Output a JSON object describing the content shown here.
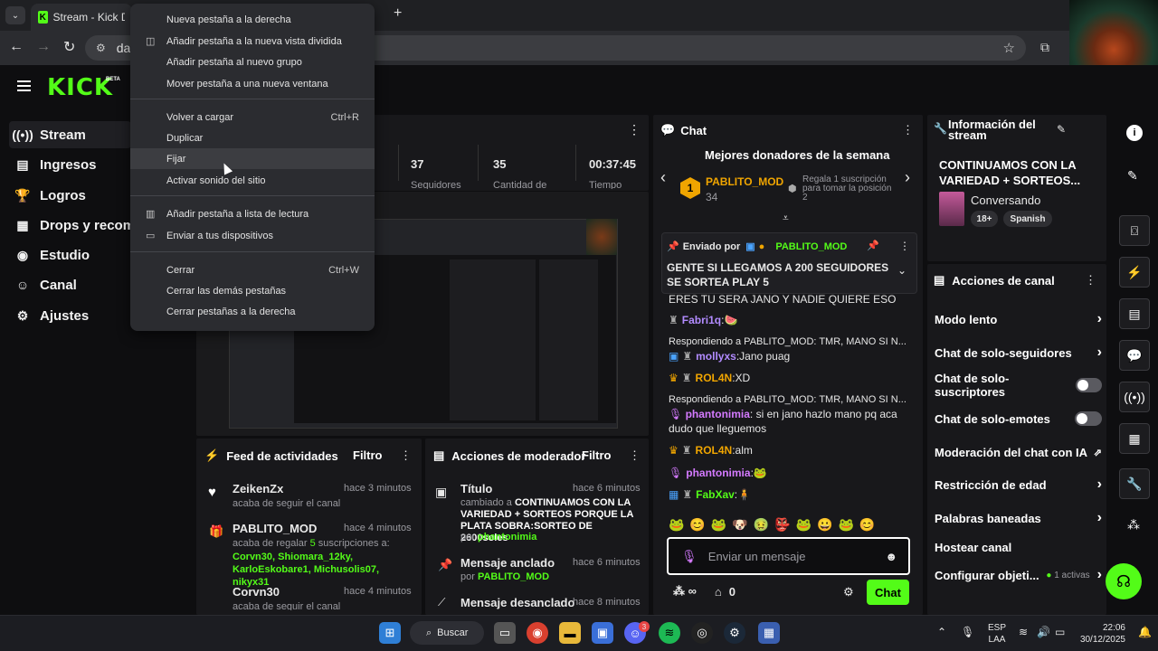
{
  "browser": {
    "tab_title": "Stream - Kick Dashl",
    "url": "da",
    "new_tab": "+"
  },
  "menu": {
    "items": [
      {
        "label": "Nueva pestaña a la derecha",
        "shortcut": ""
      },
      {
        "label": "Añadir pestaña a la nueva vista dividida",
        "shortcut": "",
        "icon": "split-view-icon"
      },
      {
        "label": "Añadir pestaña al nuevo grupo",
        "shortcut": ""
      },
      {
        "label": "Mover pestaña a una nueva ventana",
        "shortcut": ""
      },
      {
        "label": "Volver a cargar",
        "shortcut": "Ctrl+R"
      },
      {
        "label": "Duplicar",
        "shortcut": ""
      },
      {
        "label": "Fijar",
        "shortcut": ""
      },
      {
        "label": "Activar sonido del sitio",
        "shortcut": ""
      },
      {
        "label": "Añadir pestaña a lista de lectura",
        "shortcut": "",
        "icon": "reading-list-icon"
      },
      {
        "label": "Enviar a tus dispositivos",
        "shortcut": "",
        "icon": "devices-icon"
      },
      {
        "label": "Cerrar",
        "shortcut": "Ctrl+W"
      },
      {
        "label": "Cerrar las demás pestañas",
        "shortcut": ""
      },
      {
        "label": "Cerrar pestañas a la derecha",
        "shortcut": ""
      }
    ]
  },
  "kick": {
    "logo": "KICK",
    "beta": "BETA",
    "sidebar": [
      {
        "label": "Stream",
        "icon": "stream-icon"
      },
      {
        "label": "Ingresos",
        "icon": "chart-icon"
      },
      {
        "label": "Logros",
        "icon": "trophy-icon"
      },
      {
        "label": "Drops y recomp",
        "icon": "drops-icon"
      },
      {
        "label": "Estudio",
        "icon": "studio-icon"
      },
      {
        "label": "Canal",
        "icon": "channel-icon"
      },
      {
        "label": "Ajustes",
        "icon": "gear-icon"
      }
    ],
    "stats": [
      {
        "value": "37",
        "label": "Seguidores"
      },
      {
        "value": "35",
        "label": "Cantidad de"
      },
      {
        "value": "00:37:45",
        "label": "Tiempo"
      }
    ],
    "feed": {
      "title": "Feed de actividades",
      "filter": "Filtro",
      "items": [
        {
          "name": "ZeikenZx",
          "time": "hace 3 minutos",
          "text": "acaba de seguir el canal"
        },
        {
          "name": "PABLITO_MOD",
          "time": "hace 4 minutos",
          "text_pre": "acaba de regalar ",
          "count": "5",
          "text_post": " suscripciones a:",
          "recipients": "Corvn30, Shiomara_12ky, KarloEskobare1, Michusolis07, nikyx31"
        },
        {
          "name": "Corvn30",
          "time": "hace 4 minutos",
          "text": "acaba de seguir el canal"
        }
      ]
    },
    "mod": {
      "title": "Acciones de moderador",
      "filter": "Filtro",
      "items": [
        {
          "title": "Título",
          "time": "hace 6 minutos",
          "pre": "cambiado a ",
          "detail": "CONTINUAMOS CON LA VARIEDAD + SORTEOS PORQUE LA PLATA SOBRA:SORTEO DE 2600soles",
          "by_pre": "por ",
          "by": "phantonimia"
        },
        {
          "title": "Mensaje anclado",
          "time": "hace 6 minutos",
          "by_pre": "por ",
          "by": "PABLITO_MOD"
        },
        {
          "title": "Mensaje desanclado",
          "time": "hace 8 minutos"
        }
      ]
    },
    "chat": {
      "title": "Chat",
      "donors_title": "Mejores donadores de la semana",
      "donor": {
        "rank": "1",
        "name": "PABLITO_MOD",
        "amount": "34"
      },
      "gift_text": "Regala 1 suscripción para tomar la posición 2",
      "pinned_by_label": "Enviado por",
      "pinned_by": "PABLITO_MOD",
      "pinned_text": "GENTE SI LLEGAMOS A 200 SEGUIDORES SE SORTEA PLAY 5",
      "partial": "ERES TU SERA JANO Y NADIE QUIERE ESO",
      "messages": [
        {
          "user": "Fabri1q",
          "text": "",
          "color": "#b28bff"
        },
        {
          "reply": "Respondiendo a PABLITO_MOD: TMR, MANO SI N...",
          "user": "mollyxs",
          "text": "Jano puag",
          "color": "#b28bff"
        },
        {
          "user": "ROL4N",
          "text": "XD",
          "color": "#f0a500"
        },
        {
          "reply": "Respondiendo a PABLITO_MOD: TMR, MANO SI N...",
          "user": "phantonimia",
          "text": "si en jano hazlo mano pq aca dudo que lleguemos",
          "color": "#d47aff"
        },
        {
          "user": "ROL4N",
          "text": "alm",
          "color": "#f0a500"
        },
        {
          "user": "phantonimia",
          "text": "",
          "color": "#d47aff"
        },
        {
          "user": "FabXav",
          "text": "",
          "color": "#53fc18"
        }
      ],
      "placeholder": "Enviar un mensaje",
      "count": "0",
      "send": "Chat"
    },
    "info": {
      "title": "Información del stream",
      "stream_title": "CONTINUAMOS CON LA VARIEDAD + SORTEOS...",
      "category": "Conversando",
      "tags": [
        "18+",
        "Spanish"
      ]
    },
    "actions": {
      "title": "Acciones de canal",
      "items": [
        {
          "label": "Modo lento",
          "type": "chevron"
        },
        {
          "label": "Chat de solo-seguidores",
          "type": "chevron"
        },
        {
          "label": "Chat de solo-suscriptores",
          "type": "toggle"
        },
        {
          "label": "Chat de solo-emotes",
          "type": "toggle"
        },
        {
          "label": "Moderación del chat con IA",
          "type": "external"
        },
        {
          "label": "Restricción de edad",
          "type": "chevron"
        },
        {
          "label": "Palabras baneadas",
          "type": "chevron"
        },
        {
          "label": "Hostear canal",
          "type": "none"
        },
        {
          "label": "Configurar objeti...",
          "type": "chevron"
        }
      ],
      "active": "1 activas"
    }
  },
  "taskbar": {
    "search": "Buscar",
    "lang1": "ESP",
    "lang2": "LAA",
    "time": "22:06",
    "date": "30/12/2025",
    "badge": "3"
  }
}
